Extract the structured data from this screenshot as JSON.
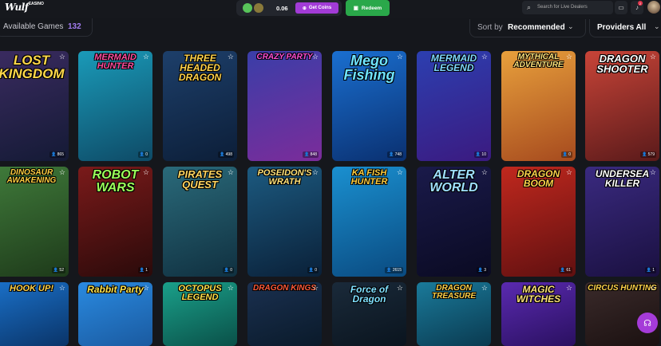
{
  "header": {
    "logo_text": "Wulf",
    "logo_sub": "CASINO",
    "wallet": {
      "amount": "0.06",
      "get_coins_label": "Get Coins",
      "gift_icon": "gift-icon"
    },
    "redeem_label": "Redeem",
    "search_placeholder": "Search for Live Dealers",
    "notification_count": "2"
  },
  "filters": {
    "available_label": "Available Games",
    "available_count": "132",
    "sort_label": "Sort by",
    "sort_value": "Recommended",
    "providers_label": "Providers All"
  },
  "games": [
    {
      "title": "LOST KINGDOM",
      "players": "865",
      "bg": [
        "#3a2b60",
        "#141a35"
      ],
      "color": "#ffd84a",
      "size": "17px"
    },
    {
      "title": "MERMAID HUNTER",
      "players": "0",
      "bg": [
        "#1a9ab8",
        "#0e4a66"
      ],
      "color": "#ff4fa0",
      "size": "11px"
    },
    {
      "title": "THREE HEADED DRAGON",
      "players": "498",
      "bg": [
        "#1d3f6a",
        "#0c1e38"
      ],
      "color": "#ffd24a",
      "size": "12px"
    },
    {
      "title": "CRAZY PARTY",
      "players": "848",
      "bg": [
        "#3a3ea8",
        "#7b2c9a"
      ],
      "color": "#ff4fd8",
      "size": "10px"
    },
    {
      "title": "Mego Fishing",
      "players": "748",
      "bg": [
        "#1a6fd0",
        "#0a3070"
      ],
      "color": "#6fe4ff",
      "size": "18px"
    },
    {
      "title": "MERMAID LEGEND",
      "players": "10",
      "bg": [
        "#2c3fb0",
        "#3b1a80"
      ],
      "color": "#7fd8ff",
      "size": "12px"
    },
    {
      "title": "MYTHICAL ADVENTURE",
      "players": "0",
      "bg": [
        "#e8a03c",
        "#a64a1e"
      ],
      "color": "#ffe27a",
      "size": "10px"
    },
    {
      "title": "DRAGON SHOOTER",
      "players": "579",
      "bg": [
        "#c84438",
        "#5a1a1a"
      ],
      "color": "#fff",
      "size": "13px"
    },
    {
      "title": "DINOSAUR AWAKENING",
      "players": "52",
      "bg": [
        "#3f7a3a",
        "#1e3a1a"
      ],
      "color": "#ffcf40",
      "size": "10px"
    },
    {
      "title": "ROBOT WARS",
      "players": "1",
      "bg": [
        "#7a1a1a",
        "#2a0a0a"
      ],
      "color": "#9cff5a",
      "size": "16px"
    },
    {
      "title": "PIRATES QUEST",
      "players": "0",
      "bg": [
        "#2a6a7a",
        "#103040"
      ],
      "color": "#ffd560",
      "size": "13px"
    },
    {
      "title": "POSEIDON'S WRATH",
      "players": "0",
      "bg": [
        "#1c5a80",
        "#0a2038"
      ],
      "color": "#ffe27a",
      "size": "11px"
    },
    {
      "title": "KA FISH HUNTER",
      "players": "2615",
      "bg": [
        "#1a90d0",
        "#0a4a80"
      ],
      "color": "#ffcf40",
      "size": "11px"
    },
    {
      "title": "ALTER WORLD",
      "players": "3",
      "bg": [
        "#1a1a4a",
        "#0a0a22"
      ],
      "color": "#9fe0ff",
      "size": "16px"
    },
    {
      "title": "DRAGON BOOM",
      "players": "61",
      "bg": [
        "#c0281e",
        "#601010"
      ],
      "color": "#ffd24a",
      "size": "12px"
    },
    {
      "title": "UNDERSEA KILLER",
      "players": "1",
      "bg": [
        "#3a2a80",
        "#1a1040"
      ],
      "color": "#ffffff",
      "size": "12px"
    },
    {
      "title": "HOOK UP!",
      "players": "",
      "bg": [
        "#1a70c8",
        "#0a3468"
      ],
      "color": "#ffd24a",
      "size": "11px"
    },
    {
      "title": "Rabbit Party",
      "players": "",
      "bg": [
        "#2a8ae0",
        "#1a5aa0"
      ],
      "color": "#ffe24a",
      "size": "12px"
    },
    {
      "title": "OCTOPUS LEGEND",
      "players": "",
      "bg": [
        "#1aa08a",
        "#0a5048"
      ],
      "color": "#ffe24a",
      "size": "11px"
    },
    {
      "title": "DRAGON KINGS",
      "players": "",
      "bg": [
        "#1a3050",
        "#0a1a2a"
      ],
      "color": "#ff5a3a",
      "size": "10px"
    },
    {
      "title": "Force of Dragon",
      "players": "",
      "bg": [
        "#1a2a3a",
        "#0a141e"
      ],
      "color": "#7fe0ff",
      "size": "12px"
    },
    {
      "title": "DRAGON TREASURE",
      "players": "",
      "bg": [
        "#1a7a9a",
        "#0a3a50"
      ],
      "color": "#ffd24a",
      "size": "10px"
    },
    {
      "title": "MAGIC WITCHES",
      "players": "",
      "bg": [
        "#5a2ab0",
        "#2a1060"
      ],
      "color": "#ffe27a",
      "size": "12px"
    },
    {
      "title": "CIRCUS HUNTING",
      "players": "",
      "bg": [
        "#3a2a2a",
        "#1a1010"
      ],
      "color": "#ffd24a",
      "size": "10px"
    }
  ]
}
